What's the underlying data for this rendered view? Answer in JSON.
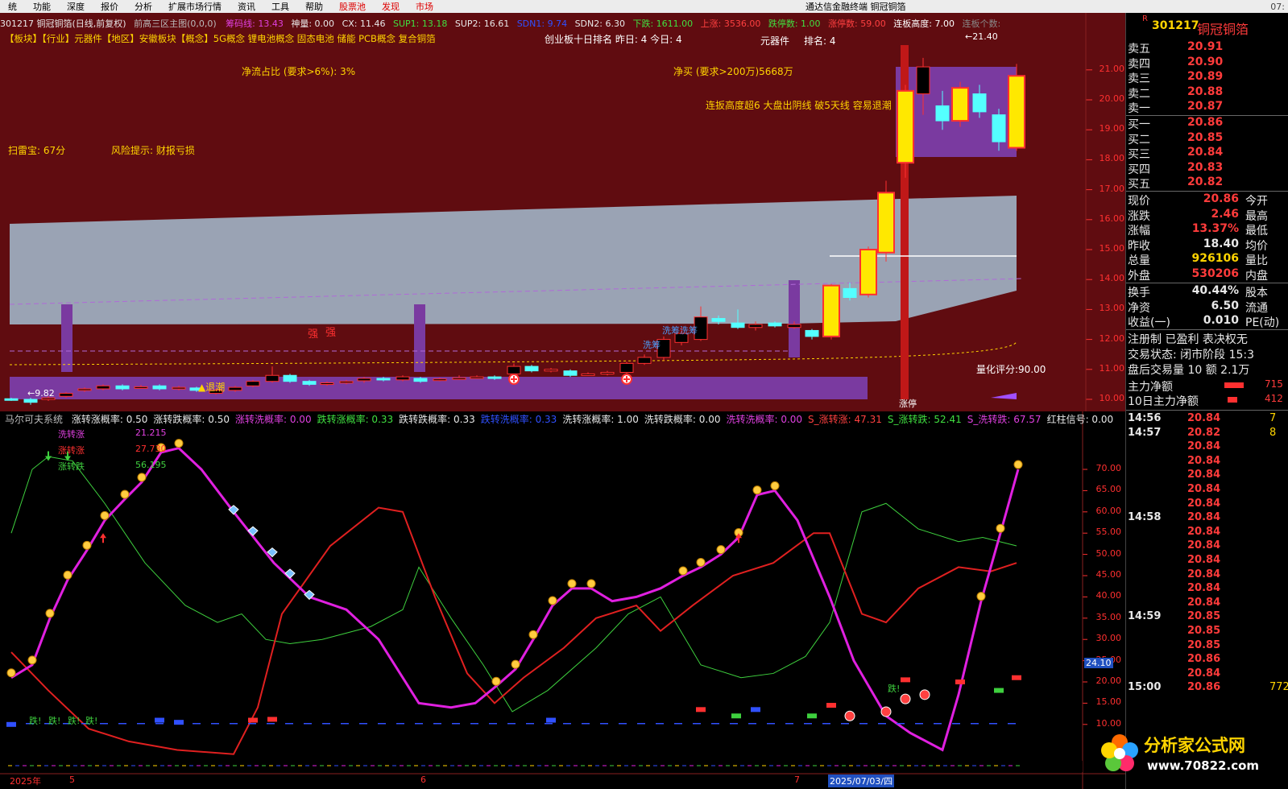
{
  "menu": {
    "items": [
      "统",
      "功能",
      "深度",
      "报价",
      "分析",
      "扩展市场行情",
      "资讯",
      "工具",
      "帮助",
      "股票池",
      "发现",
      "市场"
    ],
    "app_title": "通达信金融终端  铜冠铜箔",
    "time": "07:"
  },
  "upper_header": {
    "code_name": "301217 铜冠铜箔(日线,前复权)",
    "indicator": "前高三区主图(0,0,0)",
    "chouma": "筹码线: 13.43",
    "shenliang": "神量: 0.00",
    "cx": "CX: 11.46",
    "sup1": "SUP1: 13.18",
    "sup2": "SUP2: 16.61",
    "sdn1": "SDN1: 9.74",
    "sdn2": "SDN2: 6.30",
    "xiadie": "下跌: 1611.00",
    "shangzhang": "上涨: 3536.00",
    "dietingshu": "跌停数: 1.00",
    "zhangtingshu": "涨停数: 59.00",
    "lianban": "连板高度: 7.00",
    "lianbangeshu": "连板个数:"
  },
  "concepts": "【板块】【行业】元器件【地区】安徽板块【概念】5G概念 锂电池概念 固态电池 储能 PCB概念 复合铜箔",
  "upper_texts": {
    "chuangye": "创业板十日排名  昨日: 4    今日: 4",
    "yuanqijian": "元器件",
    "paiming": "排名: 4",
    "jingliu": "净流占比 (要求>6%): 3%",
    "jingmai": "净买 (要求>200万)5668万",
    "lianban_tip": "连扳高度超6   大盘出阴线   破5天线   容易退潮",
    "saolei": "扫雷宝:  67分",
    "fengxian": "风险提示:  财报亏损",
    "qiang1": "强",
    "qiang2": "强",
    "xichou1": "洗筹",
    "xichou2": "洗筹洗筹",
    "tuichao": "▲退潮",
    "low_price": "←9.82",
    "high_price": "←21.40",
    "lianghua": "量化评分:90.00",
    "zhangting": "涨停"
  },
  "price_axis": [
    "21.00",
    "20.00",
    "19.00",
    "18.00",
    "17.00",
    "16.00",
    "15.00",
    "14.00",
    "13.00",
    "12.00",
    "11.00",
    "10.00"
  ],
  "lower_header": {
    "name": "马尔可夫系统",
    "items": [
      {
        "t": "涨转涨概率: 0.50",
        "c": "#e8e8e8"
      },
      {
        "t": "涨转跌概率: 0.50",
        "c": "#e8e8e8"
      },
      {
        "t": "涨转洗概率: 0.00",
        "c": "#e040e0"
      },
      {
        "t": "跌转涨概率: 0.33",
        "c": "#40e040"
      },
      {
        "t": "跌转跌概率: 0.33",
        "c": "#e8e8e8"
      },
      {
        "t": "跌转洗概率: 0.33",
        "c": "#3050ff"
      },
      {
        "t": "洗转涨概率: 1.00",
        "c": "#e8e8e8"
      },
      {
        "t": "洗转跌概率: 0.00",
        "c": "#e8e8e8"
      },
      {
        "t": "洗转洗概率: 0.00",
        "c": "#e040e0"
      },
      {
        "t": "S_涨转涨: 47.31",
        "c": "#ff4040"
      },
      {
        "t": "S_涨转跌: 52.41",
        "c": "#40e040"
      },
      {
        "t": "S_洗转跌: 67.57",
        "c": "#e040e0"
      },
      {
        "t": "红柱信号: 0.00",
        "c": "#e8e8e8"
      }
    ]
  },
  "legend_lower": [
    {
      "name": "洗转涨",
      "value": "21.215",
      "color": "#e040e0"
    },
    {
      "name": "涨转涨",
      "value": "27.730",
      "color": "#ff3030"
    },
    {
      "name": "涨转跌",
      "value": "56.195",
      "color": "#40d040"
    }
  ],
  "lower_axis": [
    "70.00",
    "65.00",
    "60.00",
    "55.00",
    "50.00",
    "45.00",
    "40.00",
    "35.00",
    "30.00",
    "25.00",
    "20.00",
    "15.00",
    "10.00"
  ],
  "lower_cursor": "24.10",
  "die_labels": [
    "跌!",
    "跌!",
    "跌!",
    "跌!",
    "跌!"
  ],
  "date_axis": [
    "2025年",
    "5",
    "6",
    "7",
    "2025/07/03/四"
  ],
  "quote": {
    "code": "301217",
    "name": "铜冠铜箔",
    "tag": "R",
    "asks": [
      {
        "l": "卖五",
        "p": "20.91"
      },
      {
        "l": "卖四",
        "p": "20.90"
      },
      {
        "l": "卖三",
        "p": "20.89"
      },
      {
        "l": "卖二",
        "p": "20.88"
      },
      {
        "l": "卖一",
        "p": "20.87"
      }
    ],
    "bids": [
      {
        "l": "买一",
        "p": "20.86"
      },
      {
        "l": "买二",
        "p": "20.85"
      },
      {
        "l": "买三",
        "p": "20.84"
      },
      {
        "l": "买四",
        "p": "20.83"
      },
      {
        "l": "买五",
        "p": "20.82"
      }
    ],
    "stats": [
      {
        "l": "现价",
        "v": "20.86",
        "r": "今开",
        "vc": "#ff3b3b"
      },
      {
        "l": "涨跌",
        "v": "2.46",
        "r": "最高",
        "vc": "#ff3b3b"
      },
      {
        "l": "涨幅",
        "v": "13.37%",
        "r": "最低",
        "vc": "#ff3b3b"
      },
      {
        "l": "昨收",
        "v": "18.40",
        "r": "均价",
        "vc": "#e8e8e8"
      },
      {
        "l": "总量",
        "v": "926106",
        "r": "量比",
        "vc": "#ffd400"
      },
      {
        "l": "外盘",
        "v": "530206",
        "r": "内盘",
        "vc": "#ff3b3b"
      }
    ],
    "stats2": [
      {
        "l": "换手",
        "v": "40.44%",
        "r": "股本"
      },
      {
        "l": "净资",
        "v": "6.50",
        "r": "流通"
      },
      {
        "l": "收益(一)",
        "v": "0.010",
        "r": "PE(动)"
      }
    ],
    "zhuce": "注册制 已盈利 表决权无",
    "jiaoyi_state": "交易状态: 闭市阶段 15:3",
    "panhou": "盘后交易量 10 额 2.1万",
    "zhuli": "主力净额",
    "zhuli_v": "715",
    "zhuli10": "10日主力净额",
    "zhuli10_v": "412",
    "ticks": [
      {
        "t": "14:56",
        "p": "20.84",
        "v": "7"
      },
      {
        "t": "14:57",
        "p": "20.82",
        "v": "8"
      },
      {
        "t": "",
        "p": "20.84",
        "v": ""
      },
      {
        "t": "",
        "p": "20.84",
        "v": ""
      },
      {
        "t": "",
        "p": "20.84",
        "v": ""
      },
      {
        "t": "",
        "p": "20.84",
        "v": ""
      },
      {
        "t": "",
        "p": "20.84",
        "v": ""
      },
      {
        "t": "14:58",
        "p": "20.84",
        "v": ""
      },
      {
        "t": "",
        "p": "20.84",
        "v": ""
      },
      {
        "t": "",
        "p": "20.84",
        "v": ""
      },
      {
        "t": "",
        "p": "20.84",
        "v": ""
      },
      {
        "t": "",
        "p": "20.84",
        "v": ""
      },
      {
        "t": "",
        "p": "20.84",
        "v": ""
      },
      {
        "t": "",
        "p": "20.84",
        "v": ""
      },
      {
        "t": "14:59",
        "p": "20.85",
        "v": ""
      },
      {
        "t": "",
        "p": "20.85",
        "v": ""
      },
      {
        "t": "",
        "p": "20.85",
        "v": ""
      },
      {
        "t": "",
        "p": "20.86",
        "v": ""
      },
      {
        "t": "",
        "p": "20.84",
        "v": ""
      },
      {
        "t": "15:00",
        "p": "20.86",
        "v": "772"
      }
    ]
  },
  "watermark": "分析家公式网",
  "watermark_url": "www.70822.com"
}
